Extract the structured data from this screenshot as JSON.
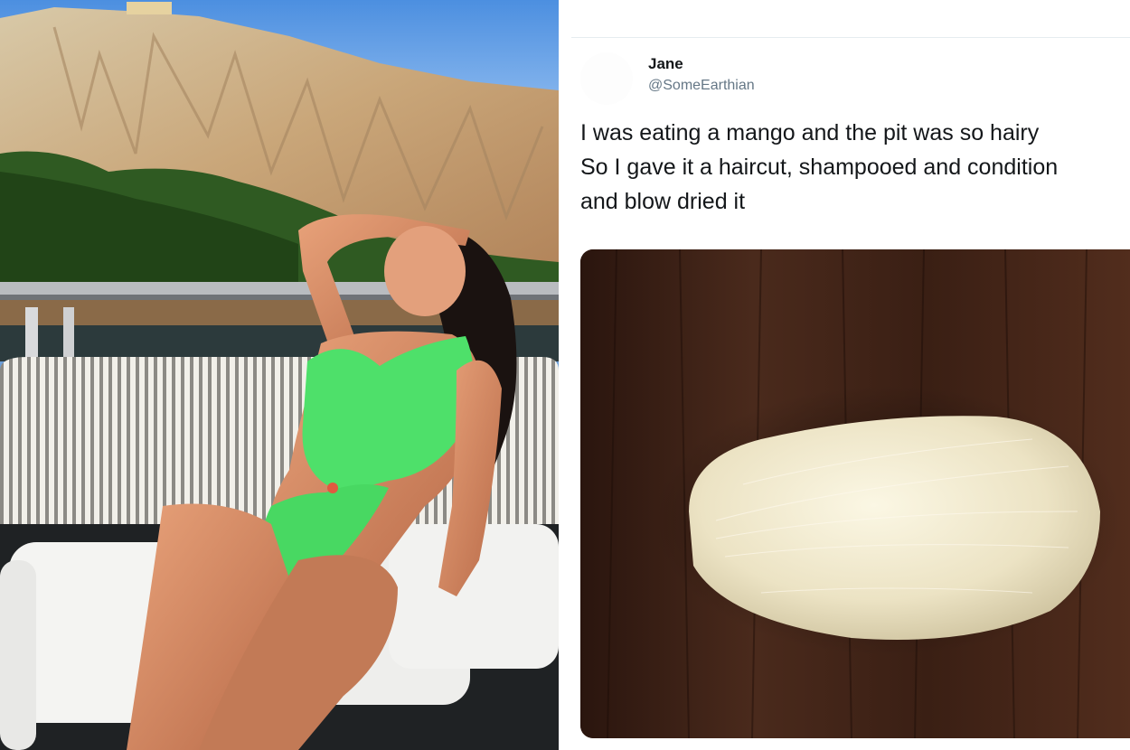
{
  "tweet": {
    "display_name": "Jane",
    "handle": "@SomeEarthian",
    "text_lines": [
      "I was eating a mango and the pit was so hairy",
      "So I gave it a haircut, shampooed and condition",
      "and blow dried it"
    ]
  },
  "icons": {
    "avatar": "avatar-placeholder"
  },
  "colors": {
    "name": "#14171a",
    "handle": "#657786",
    "swimsuit": "#4ee06a"
  }
}
